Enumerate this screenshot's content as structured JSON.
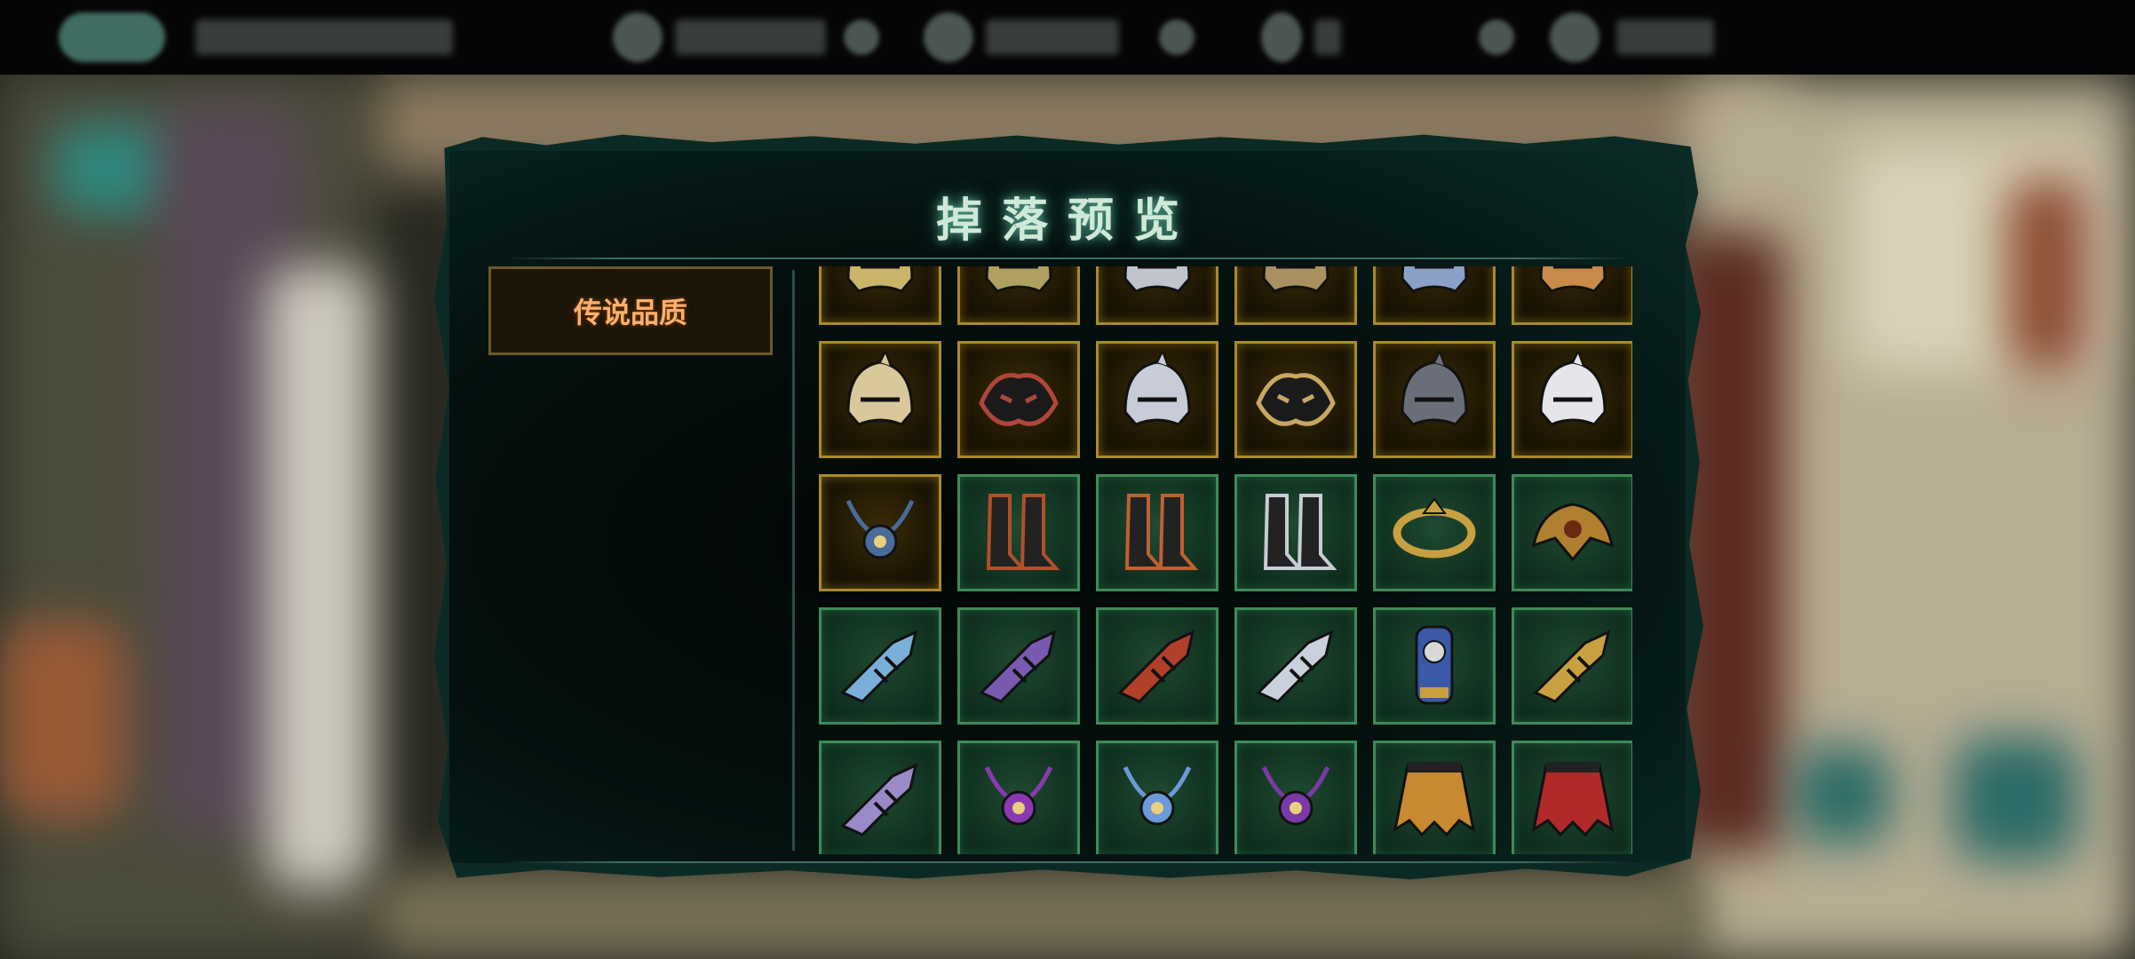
{
  "modal": {
    "title": "掉落预览",
    "category_tab": "传说品质"
  },
  "colors": {
    "legendary_border": "#a88a2a",
    "epic_border": "#3f8a57",
    "title_glow": "#4fa08a",
    "tab_text": "#ffb06a"
  },
  "items": [
    {
      "icon": "helmet-icon",
      "rarity": "legendary",
      "color": "#c9b46a"
    },
    {
      "icon": "helmet-icon",
      "rarity": "legendary",
      "color": "#b0a060"
    },
    {
      "icon": "helmet-icon",
      "rarity": "legendary",
      "color": "#c0c4cc"
    },
    {
      "icon": "helmet-icon",
      "rarity": "legendary",
      "color": "#a89060"
    },
    {
      "icon": "helmet-icon",
      "rarity": "legendary",
      "color": "#8aa0c8"
    },
    {
      "icon": "helmet-icon",
      "rarity": "legendary",
      "color": "#c98a4a"
    },
    {
      "icon": "helmet-icon",
      "rarity": "legendary",
      "color": "#d8c89a"
    },
    {
      "icon": "mask-icon",
      "rarity": "legendary",
      "color": "#b0463a"
    },
    {
      "icon": "helmet-icon",
      "rarity": "legendary",
      "color": "#c8ccd8"
    },
    {
      "icon": "mask-icon",
      "rarity": "legendary",
      "color": "#c8a860"
    },
    {
      "icon": "helmet-icon",
      "rarity": "legendary",
      "color": "#6a6e78"
    },
    {
      "icon": "helmet-icon",
      "rarity": "legendary",
      "color": "#e6e6ea"
    },
    {
      "icon": "amulet-icon",
      "rarity": "legendary",
      "color": "#4a6a9a"
    },
    {
      "icon": "boots-icon",
      "rarity": "epic",
      "color": "#b0502a"
    },
    {
      "icon": "boots-icon",
      "rarity": "epic",
      "color": "#c06030"
    },
    {
      "icon": "boots-icon",
      "rarity": "epic",
      "color": "#c8ccd4"
    },
    {
      "icon": "ring-icon",
      "rarity": "epic",
      "color": "#c8a040"
    },
    {
      "icon": "shoulder-icon",
      "rarity": "epic",
      "color": "#b08030"
    },
    {
      "icon": "gauntlet-icon",
      "rarity": "epic",
      "color": "#7ab0d8"
    },
    {
      "icon": "gauntlet-icon",
      "rarity": "epic",
      "color": "#7a5ab0"
    },
    {
      "icon": "gauntlet-icon",
      "rarity": "epic",
      "color": "#b0402a"
    },
    {
      "icon": "gauntlet-icon",
      "rarity": "epic",
      "color": "#c8d0dc"
    },
    {
      "icon": "bracer-icon",
      "rarity": "epic",
      "color": "#3a58a8"
    },
    {
      "icon": "gauntlet-icon",
      "rarity": "epic",
      "color": "#c8a040"
    },
    {
      "icon": "gauntlet-icon",
      "rarity": "epic",
      "color": "#9a8ac8"
    },
    {
      "icon": "amulet-icon",
      "rarity": "epic",
      "color": "#8a3ab0"
    },
    {
      "icon": "amulet-icon",
      "rarity": "epic",
      "color": "#6a9ad8"
    },
    {
      "icon": "amulet-icon",
      "rarity": "epic",
      "color": "#7a3aa8"
    },
    {
      "icon": "skirt-icon",
      "rarity": "epic",
      "color": "#c88a30"
    },
    {
      "icon": "skirt-icon",
      "rarity": "epic",
      "color": "#b02a2a"
    }
  ]
}
